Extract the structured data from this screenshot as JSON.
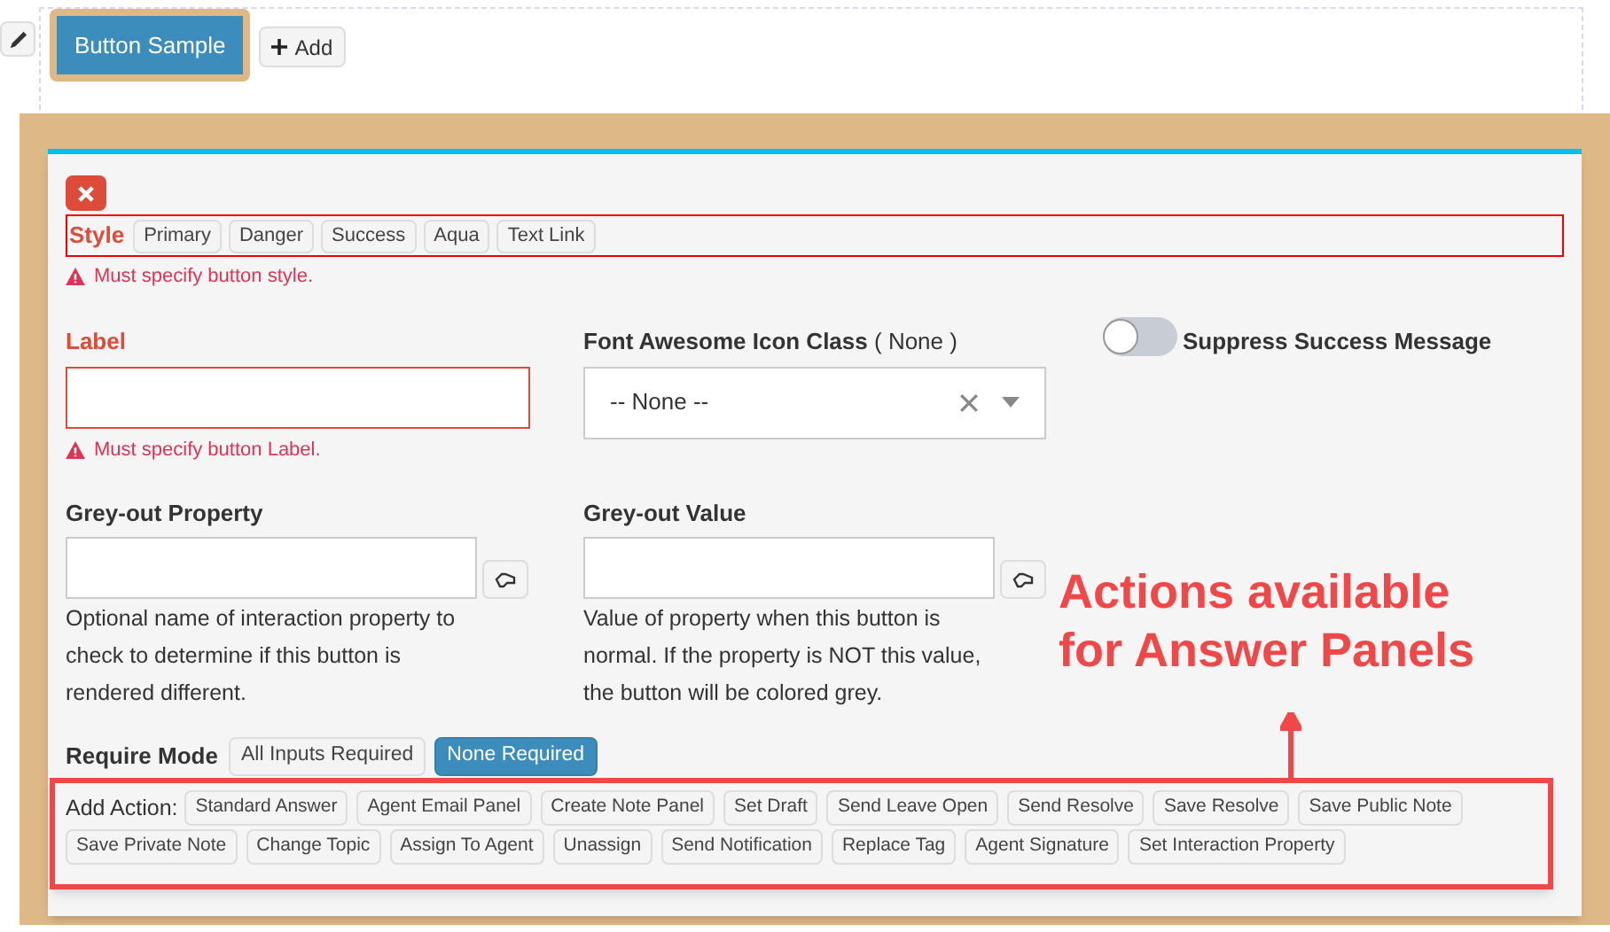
{
  "toolbar": {
    "sample_button": "Button Sample",
    "add_button": "Add"
  },
  "style": {
    "label": "Style",
    "invalid": true,
    "error": "Must specify button style.",
    "options": [
      {
        "label": "Primary",
        "selected": false
      },
      {
        "label": "Danger",
        "selected": false
      },
      {
        "label": "Success",
        "selected": false
      },
      {
        "label": "Aqua",
        "selected": false
      },
      {
        "label": "Text Link",
        "selected": false
      }
    ]
  },
  "label_field": {
    "label": "Label",
    "invalid": true,
    "error": "Must specify button Label."
  },
  "icon_field": {
    "label": "Font Awesome Icon Class",
    "current": "( None )",
    "value": "-- None --"
  },
  "suppress": {
    "label": "Suppress Success Message",
    "on": false
  },
  "greyout_property": {
    "label": "Grey-out Property",
    "help": "Optional name of interaction property to check to determine if this button is rendered different."
  },
  "greyout_value": {
    "label": "Grey-out Value",
    "help": "Value of property when this button is normal. If the property is NOT this value, the button will be colored grey."
  },
  "require_mode": {
    "label": "Require Mode",
    "options": [
      {
        "label": "All Inputs Required",
        "selected": false
      },
      {
        "label": "None Required",
        "selected": true
      }
    ]
  },
  "add_action": {
    "label": "Add Action:",
    "actions": [
      "Standard Answer",
      "Agent Email Panel",
      "Create Note Panel",
      "Set Draft",
      "Send Leave Open",
      "Send Resolve",
      "Save Resolve",
      "Save Public Note",
      "Save Private Note",
      "Change Topic",
      "Assign To Agent",
      "Unassign",
      "Send Notification",
      "Replace Tag",
      "Agent Signature",
      "Set Interaction Property"
    ]
  },
  "annotation": {
    "text": "Actions available for Answer Panels"
  }
}
